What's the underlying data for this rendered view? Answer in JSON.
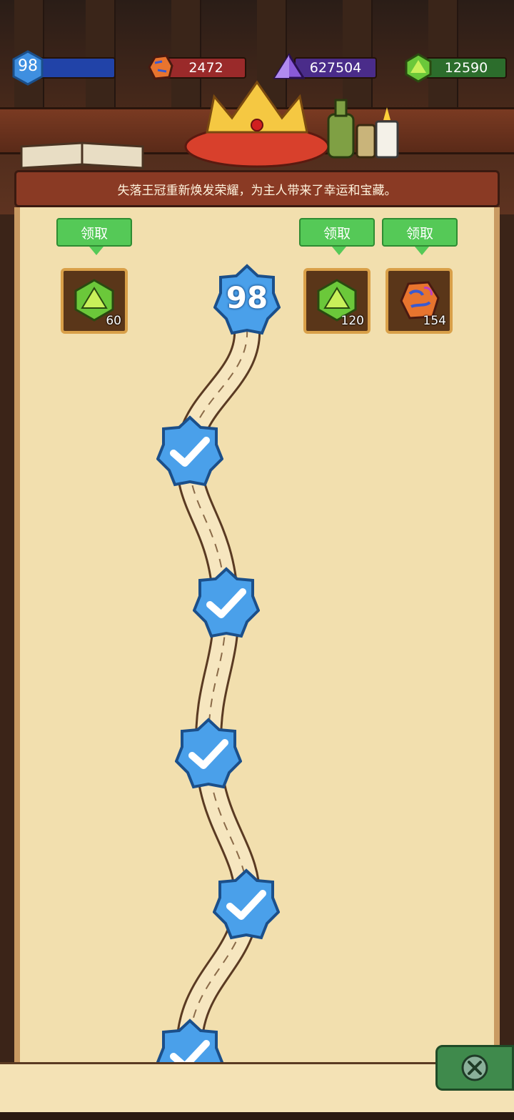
{
  "resources": {
    "level": "98",
    "ore": "2472",
    "crystal": "627504",
    "gem": "12590"
  },
  "banner": {
    "text": "失落王冠重新焕发荣耀，为主人带来了幸运和宝藏。"
  },
  "rewards": [
    {
      "claim_label": "领取",
      "count": "60",
      "icon": "green-gem-icon"
    },
    {
      "claim_label": "领取",
      "count": "120",
      "icon": "green-gem-icon"
    },
    {
      "claim_label": "领取",
      "count": "154",
      "icon": "ore-icon"
    }
  ],
  "current_level": "98",
  "completed_nodes_icon": "checkmark-icon",
  "colors": {
    "level_blue": "#3f8fe0",
    "ore_red": "#9a2a2a",
    "crystal_purple": "#4a2c8a",
    "gem_green": "#2c6d2c",
    "claim_green": "#55c957",
    "parchment": "#f2dfae"
  }
}
